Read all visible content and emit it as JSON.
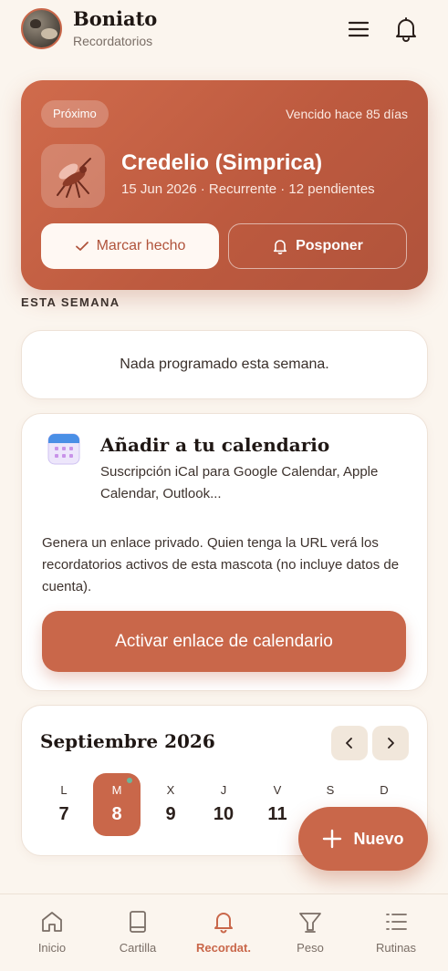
{
  "header": {
    "title": "Boniato",
    "subtitle": "Recordatorios",
    "avatar_icon": "pet-photo-avatar",
    "menu_icon": "hamburger-menu-icon",
    "bell_icon": "bell-icon"
  },
  "next_reminder": {
    "badge": "Próximo",
    "status": "Vencido hace 85 días",
    "icon": "mosquito-icon",
    "title": "Credelio (Simprica)",
    "meta": "15 Jun 2026 · Recurrente · 12 pendientes",
    "done_label": "Marcar hecho",
    "snooze_label": "Posponer"
  },
  "week": {
    "label": "ESTA SEMANA",
    "empty_text": "Nada programado esta semana."
  },
  "calendar_subscribe": {
    "title": "Añadir a tu calendario",
    "subtitle": "Suscripción iCal para Google Calendar, Apple Calendar, Outlook...",
    "body": "Genera un enlace privado. Quien tenga la URL verá los recordatorios activos de esta mascota (no incluye datos de cuenta).",
    "button": "Activar enlace de calendario"
  },
  "month": {
    "title": "Septiembre 2026",
    "days": [
      {
        "letter": "L",
        "num": "7"
      },
      {
        "letter": "M",
        "num": "8"
      },
      {
        "letter": "X",
        "num": "9"
      },
      {
        "letter": "J",
        "num": "10"
      },
      {
        "letter": "V",
        "num": "11"
      },
      {
        "letter": "S",
        "num": ""
      },
      {
        "letter": "D",
        "num": ""
      }
    ]
  },
  "fab": {
    "label": "Nuevo"
  },
  "bottom_nav": [
    {
      "label": "Inicio",
      "icon": "home-icon"
    },
    {
      "label": "Cartilla",
      "icon": "book-icon"
    },
    {
      "label": "Recordat.",
      "icon": "bell-icon"
    },
    {
      "label": "Peso",
      "icon": "scale-icon"
    },
    {
      "label": "Rutinas",
      "icon": "list-icon"
    }
  ],
  "colors": {
    "accent": "#c9674a",
    "background": "#fbf5ee",
    "today_dot": "#6cb59a"
  }
}
